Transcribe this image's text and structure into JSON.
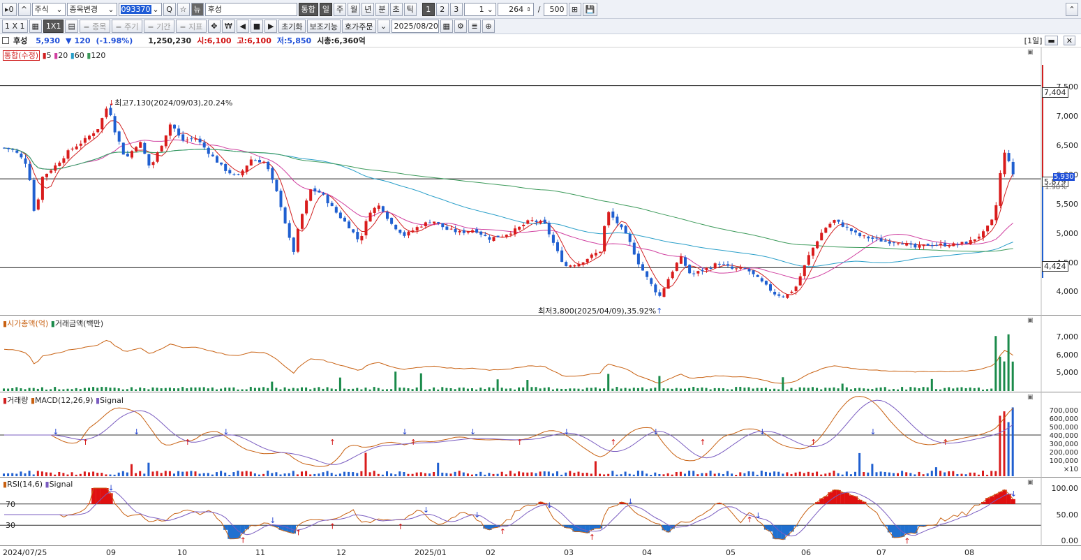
{
  "toolbar1": {
    "mode_btn": "▸0",
    "up_btn": "^",
    "market": "주식",
    "change": "종목변경",
    "code": "093370",
    "search_icon": "Q",
    "star_icon": "☆",
    "news": "뉴",
    "name": "후성",
    "integrated": "통합",
    "periods": [
      "일",
      "주",
      "월",
      "년",
      "분",
      "초",
      "틱"
    ],
    "multipliers": [
      "1",
      "2",
      "3"
    ],
    "n_value": "1",
    "count": "264",
    "slash": "/",
    "max": "500"
  },
  "toolbar2": {
    "zoom1": "1 X 1",
    "grid_icon": "▦",
    "zoom2": "1X1",
    "chart_icon": "▤",
    "stock": "= 종목",
    "period": "= 주기",
    "range": "= 기간",
    "indicator": "= 지표",
    "move_icon": "✥",
    "won_icon": "₩",
    "prev": "◀",
    "stop": "■",
    "next": "▶",
    "reset": "초기화",
    "aux": "보조기능",
    "quote": "호가주문",
    "date": "2025/08/20"
  },
  "info": {
    "name": "후성",
    "price": "5,930",
    "arrow": "▼",
    "change": "120",
    "pct": "(-1.98%)",
    "volume": "1,250,230",
    "open": "시:6,100",
    "high": "고:6,100",
    "low": "저:5,850",
    "cap": "시총:6,360억",
    "period": "[1일]"
  },
  "price_pane": {
    "legend": [
      "통합(수정)",
      "5",
      "20",
      "60",
      "120"
    ],
    "legend_colors": [
      "#d02020",
      "#d02020",
      "#d040a0",
      "#2a9fc9",
      "#3c9a5a"
    ],
    "ticks": [
      "7,500",
      "7,000",
      "6,500",
      "6,000",
      "5,500",
      "5,000",
      "4,500",
      "4,000"
    ],
    "hline_labels": [
      "7,404",
      "5,879",
      "4,424"
    ],
    "cur_price": "5,930",
    "cur_pct": "1.98%",
    "high_note": "최고7,130(2024/09/03),20.24%",
    "low_note": "최저3,800(2025/04/09),35.92%"
  },
  "cap_pane": {
    "legend": [
      "시가총액(억)",
      "거래금액(백만)"
    ],
    "ticks": [
      "7,000",
      "6,000",
      "5,000"
    ]
  },
  "macd_pane": {
    "legend": [
      "거래량",
      "MACD(12,26,9)",
      "Signal"
    ],
    "ticks": [
      "700,000",
      "600,000",
      "500,000",
      "400,000",
      "300,000",
      "200,000",
      "100,000",
      "×10"
    ]
  },
  "rsi_pane": {
    "legend": [
      "RSI(14,6)",
      "Signal"
    ],
    "ticks": [
      "100.00",
      "50.00",
      "0.00"
    ],
    "levels": [
      "70",
      "30"
    ]
  },
  "x_axis": [
    "2024/07/25",
    "09",
    "10",
    "11",
    "12",
    "2025/01",
    "02",
    "03",
    "04",
    "05",
    "06",
    "07",
    "08"
  ],
  "chart_data": {
    "type": "candlestick",
    "title": "후성",
    "period": "daily",
    "ylim": [
      3800,
      7800
    ],
    "price_path": [
      [
        0,
        6400
      ],
      [
        20,
        6350
      ],
      [
        40,
        6100
      ],
      [
        50,
        5250
      ],
      [
        60,
        5900
      ],
      [
        80,
        6100
      ],
      [
        100,
        6350
      ],
      [
        120,
        6500
      ],
      [
        140,
        6700
      ],
      [
        155,
        7100
      ],
      [
        165,
        6650
      ],
      [
        180,
        6200
      ],
      [
        200,
        6500
      ],
      [
        215,
        6050
      ],
      [
        230,
        6400
      ],
      [
        245,
        6800
      ],
      [
        260,
        6500
      ],
      [
        280,
        6550
      ],
      [
        300,
        6300
      ],
      [
        320,
        6050
      ],
      [
        340,
        5900
      ],
      [
        360,
        6200
      ],
      [
        380,
        6150
      ],
      [
        400,
        5550
      ],
      [
        410,
        5100
      ],
      [
        420,
        4650
      ],
      [
        430,
        5200
      ],
      [
        445,
        5700
      ],
      [
        460,
        5650
      ],
      [
        480,
        5350
      ],
      [
        500,
        5100
      ],
      [
        515,
        4850
      ],
      [
        530,
        5350
      ],
      [
        545,
        5450
      ],
      [
        560,
        5150
      ],
      [
        580,
        4950
      ],
      [
        600,
        5100
      ],
      [
        620,
        5200
      ],
      [
        640,
        5050
      ],
      [
        660,
        5000
      ],
      [
        680,
        5050
      ],
      [
        700,
        4900
      ],
      [
        720,
        4950
      ],
      [
        740,
        5050
      ],
      [
        760,
        5200
      ],
      [
        780,
        5150
      ],
      [
        800,
        4650
      ],
      [
        810,
        4450
      ],
      [
        830,
        4500
      ],
      [
        860,
        4700
      ],
      [
        870,
        5350
      ],
      [
        885,
        5150
      ],
      [
        900,
        4900
      ],
      [
        915,
        4500
      ],
      [
        930,
        4200
      ],
      [
        945,
        3950
      ],
      [
        960,
        4300
      ],
      [
        975,
        4600
      ],
      [
        990,
        4300
      ],
      [
        1010,
        4400
      ],
      [
        1030,
        4500
      ],
      [
        1050,
        4400
      ],
      [
        1070,
        4400
      ],
      [
        1090,
        4200
      ],
      [
        1110,
        4000
      ],
      [
        1125,
        3950
      ],
      [
        1140,
        4100
      ],
      [
        1160,
        4650
      ],
      [
        1180,
        5050
      ],
      [
        1195,
        5200
      ],
      [
        1210,
        5100
      ],
      [
        1230,
        4950
      ],
      [
        1250,
        4900
      ],
      [
        1270,
        4850
      ],
      [
        1290,
        4850
      ],
      [
        1310,
        4750
      ],
      [
        1330,
        4800
      ],
      [
        1350,
        4800
      ],
      [
        1370,
        4800
      ],
      [
        1390,
        4850
      ],
      [
        1410,
        5000
      ],
      [
        1425,
        5250
      ],
      [
        1435,
        6100
      ],
      [
        1442,
        6400
      ],
      [
        1450,
        5930
      ]
    ]
  }
}
